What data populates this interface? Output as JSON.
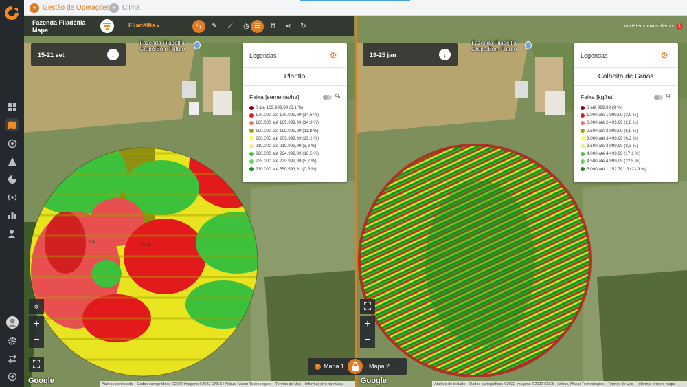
{
  "colors": {
    "accent": "#e07d24",
    "sidebar": "#25292e"
  },
  "sidebar": {
    "icons": [
      "dashboard-icon",
      "map-icon",
      "wifi-icon",
      "alert-icon",
      "pie-chart-icon",
      "antenna-icon",
      "bar-chart-icon",
      "user-icon",
      "avatar",
      "gear-icon",
      "swap-icon",
      "logout-icon"
    ]
  },
  "tabs": [
    {
      "label": "Gestão de Operações"
    },
    {
      "label": "Clima"
    }
  ],
  "header": {
    "farm": "Fazenda Filadélfia",
    "section": "Mapa",
    "city": "Filadélfia",
    "alerts_text": "Você tem novos alertas",
    "alerts_count": "1"
  },
  "map_labels": {
    "place_line1": "Fazenda Filadélfia",
    "place_line2": "Grupo Bom Futuro",
    "field_number": "104",
    "field_name": "Pivô 6"
  },
  "left": {
    "date": "15-21 set",
    "legend": {
      "title": "Legendas",
      "subtitle": "Plantio",
      "field": "Faixa [semente/ha]",
      "pct": "%",
      "items": [
        {
          "text": "0 até 169.999,99 (3,1 %)",
          "color": "#8b0000"
        },
        {
          "text": "170.000 até 179.999,99 (14,6 %)",
          "color": "#e31a1c"
        },
        {
          "text": "180.000 até 189.999,99 (14,9 %)",
          "color": "#f07070"
        },
        {
          "text": "190.000 até 199.999,99 (11,8 %)",
          "color": "#a0a000"
        },
        {
          "text": "200.000 até 209.999,99 (29,2 %)",
          "color": "#ffff33"
        },
        {
          "text": "210.000 até 219.999,99 (3,3 %)",
          "color": "#f5f06a"
        },
        {
          "text": "220.000 até 224.999,99 (16,5 %)",
          "color": "#33cc33"
        },
        {
          "text": "225.000 até 229.999,99 (5,7 %)",
          "color": "#5cd65c"
        },
        {
          "text": "230.000 até 550.593,31 (0,5 %)",
          "color": "#1a8a1a"
        }
      ]
    }
  },
  "right": {
    "date": "19-25 jan",
    "legend": {
      "title": "Legendas",
      "subtitle": "Colheita de Grãos",
      "field": "Faixa [kg/ha]",
      "pct": "%",
      "items": [
        {
          "text": "0 até 999,99 (9 %)",
          "color": "#8b0000"
        },
        {
          "text": "1.000 até 1.999,99 (2,9 %)",
          "color": "#e31a1c"
        },
        {
          "text": "2.000 até 2.499,99 (2,8 %)",
          "color": "#f07070"
        },
        {
          "text": "2.500 até 2.999,99 (6,9 %)",
          "color": "#a0a000"
        },
        {
          "text": "3.000 até 3.499,99 (6,2 %)",
          "color": "#ffff33"
        },
        {
          "text": "3.500 até 3.999,99 (8,3 %)",
          "color": "#f5f06a"
        },
        {
          "text": "4.000 até 4.499,99 (17,1 %)",
          "color": "#33cc33"
        },
        {
          "text": "4.500 até 4.999,99 (22,5 %)",
          "color": "#5cd65c"
        },
        {
          "text": "5.000 até 1.152.791,5 (23,9 %)",
          "color": "#1a8a1a"
        }
      ]
    }
  },
  "attribution": {
    "shortcuts": "Atalhos do teclado",
    "mapdata": "Dados cartográficos ©2022 Imagens ©2022 CNES / Airbus, Maxar Technologies",
    "terms": "Termos de Uso",
    "report": "Informar erro no mapa",
    "google": "Google"
  },
  "switcher": {
    "map1": "Mapa 1",
    "map2": "Mapa 2"
  }
}
